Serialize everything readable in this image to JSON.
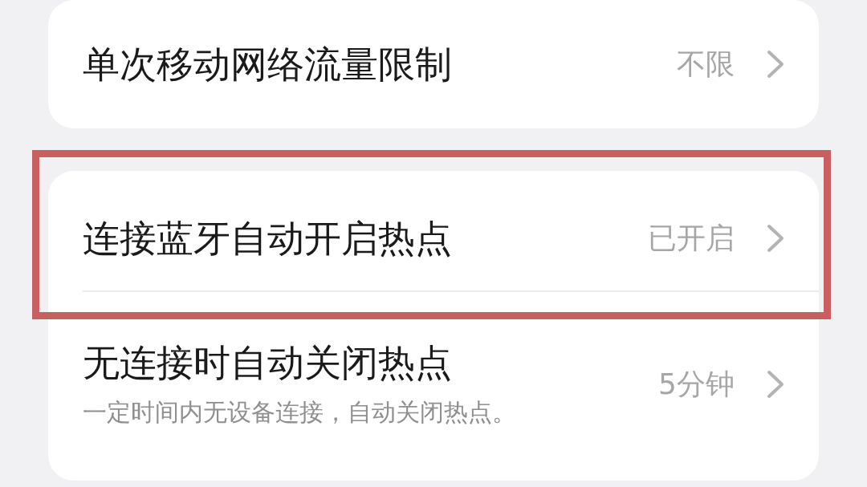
{
  "groups": [
    {
      "items": [
        {
          "title": "单次移动网络流量限制",
          "value": "不限",
          "highlighted": false
        }
      ]
    },
    {
      "items": [
        {
          "title": "连接蓝牙自动开启热点",
          "value": "已开启",
          "highlighted": true
        },
        {
          "title": "无连接时自动关闭热点",
          "subtitle": "一定时间内无设备连接，自动关闭热点。",
          "value": "5分钟",
          "highlighted": false
        }
      ]
    }
  ]
}
